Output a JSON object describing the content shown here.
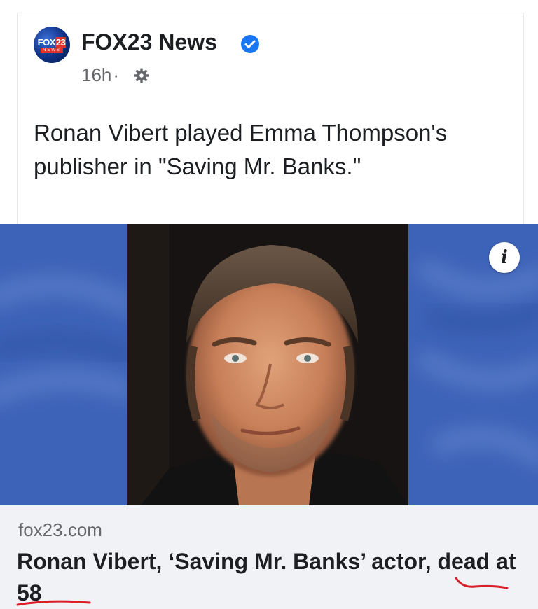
{
  "post": {
    "page_name": "FOX23 News",
    "verified_icon": "verified-badge-icon",
    "time_ago": "16h",
    "separator": "·",
    "audience_icon": "gear-icon",
    "text": "Ronan Vibert played Emma Thompson's publisher in \"Saving Mr. Banks.\""
  },
  "avatar": {
    "logo_text": "FOX",
    "logo_number": "23",
    "logo_sub": "NEWS"
  },
  "image": {
    "info_label": "i"
  },
  "link_preview": {
    "domain": "fox23.com",
    "headline": "Ronan Vibert, ‘Saving Mr. Banks’ actor, dead at 58"
  },
  "colors": {
    "verified_blue": "#1877f2",
    "image_background_blue": "#3d63b8",
    "annotation_red": "#d81f2a",
    "link_box_bg": "#f0f2f5"
  }
}
